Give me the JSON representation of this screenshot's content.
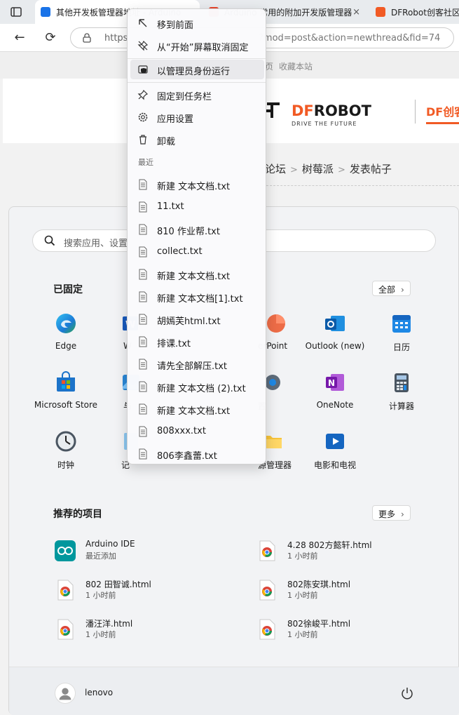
{
  "browser": {
    "tabs": [
      {
        "label": "其他开发板管理器地址 - Arduino",
        "favicon_color": "#1a73e8",
        "close": "×"
      },
      {
        "label": "Arduino 常用的附加开发版管理器",
        "favicon_color": "#e8452c",
        "close": "×"
      },
      {
        "label": "DFRobot创客社区 - 开源",
        "favicon_color": "#f15a24"
      }
    ],
    "url_prefix": "https",
    "url_rest": "?mod=post&action=newthread&fid=74"
  },
  "webpage": {
    "topbar": {
      "link1": "页",
      "link2": "收藏本站"
    },
    "logo": {
      "df": "DF",
      "robot": "ROBOT",
      "tagline": "DRIVE THE FUTURE"
    },
    "site_tag": "DF创客",
    "breadcrumb": [
      "论坛",
      "树莓派",
      "发表帖子"
    ]
  },
  "start_menu": {
    "search_placeholder": "搜索应用、设置",
    "pinned_title": "已固定",
    "all_button": "全部",
    "pinned_apps": [
      {
        "label": "Edge",
        "icon": "edge-icon"
      },
      {
        "label": "W",
        "icon": "word-icon"
      },
      {
        "label": "erPoint",
        "icon": "powerpoint-icon"
      },
      {
        "label": "Outlook (new)",
        "icon": "outlook-icon"
      },
      {
        "label": "日历",
        "icon": "calendar-icon"
      },
      {
        "label": "Microsoft Store",
        "icon": "store-icon"
      },
      {
        "label": "与",
        "icon": "photos-icon"
      },
      {
        "label": "置",
        "icon": "settings-icon"
      },
      {
        "label": "OneNote",
        "icon": "onenote-icon"
      },
      {
        "label": "计算器",
        "icon": "calculator-icon"
      },
      {
        "label": "时钟",
        "icon": "clock-icon"
      },
      {
        "label": "记",
        "icon": "notepad-icon"
      },
      {
        "label": "源管理器",
        "icon": "file-explorer-icon"
      },
      {
        "label": "电影和电视",
        "icon": "movies-icon"
      }
    ],
    "recommended_title": "推荐的项目",
    "more_button": "更多",
    "recommended": [
      {
        "name": "Arduino IDE",
        "sub": "最近添加",
        "icon": "arduino-icon"
      },
      {
        "name": "4.28  802方懿轩.html",
        "sub": "1 小时前",
        "icon": "chrome-file-icon"
      },
      {
        "name": "802 田智诚.html",
        "sub": "1 小时前",
        "icon": "chrome-file-icon"
      },
      {
        "name": "802陈安琪.html",
        "sub": "1 小时前",
        "icon": "chrome-file-icon"
      },
      {
        "name": "潘汪洋.html",
        "sub": "1 小时前",
        "icon": "chrome-file-icon"
      },
      {
        "name": "802徐峻平.html",
        "sub": "1 小时前",
        "icon": "chrome-file-icon"
      }
    ],
    "user": "lenovo"
  },
  "context_menu": {
    "actions": [
      {
        "label": "移到前面",
        "icon": "arrow-up-left-icon"
      },
      {
        "label": "从“开始”屏幕取消固定",
        "icon": "unpin-icon"
      },
      {
        "label": "以管理员身份运行",
        "icon": "admin-shield-icon"
      },
      {
        "label": "固定到任务栏",
        "icon": "pin-icon"
      },
      {
        "label": "应用设置",
        "icon": "gear-icon"
      },
      {
        "label": "卸载",
        "icon": "trash-icon"
      }
    ],
    "recent_header": "最近",
    "recent": [
      "新建 文本文档.txt",
      "11.txt",
      "810 作业帮.txt",
      "collect.txt",
      "新建 文本文档.txt",
      "新建 文本文档[1].txt",
      "胡嫣芙html.txt",
      "排课.txt",
      "请先全部解压.txt",
      "新建 文本文档 (2).txt",
      "新建 文本文档.txt",
      "808xxx.txt",
      "806李鑫蕾.txt"
    ]
  }
}
